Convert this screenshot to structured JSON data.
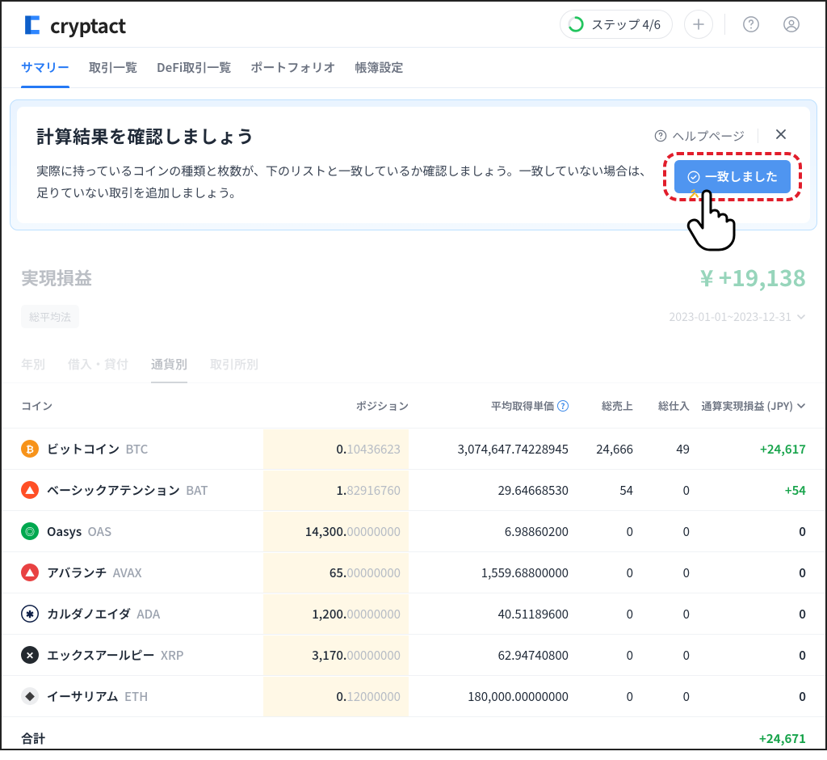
{
  "brand": "cryptact",
  "step": {
    "label": "ステップ 4/6",
    "percent": 67
  },
  "nav": [
    {
      "label": "サマリー",
      "active": true
    },
    {
      "label": "取引一覧"
    },
    {
      "label": "DeFi取引一覧"
    },
    {
      "label": "ポートフォリオ"
    },
    {
      "label": "帳簿設定"
    }
  ],
  "banner": {
    "title": "計算結果を確認しましょう",
    "help_label": "ヘルプページ",
    "text": "実際に持っているコインの種類と枚数が、下のリストと一致しているか確認しましょう。一致していない場合は、足りていない取引を追加しましょう。",
    "confirm_label": "一致しました"
  },
  "realized": {
    "title": "実現損益",
    "value": "¥ +19,138",
    "method_chip": "総平均法",
    "date_range": "2023-01-01~2023-12-31"
  },
  "filter_tabs": [
    {
      "label": "年別"
    },
    {
      "label": "借入・貸付"
    },
    {
      "label": "通貨別",
      "active": true
    },
    {
      "label": "取引所別"
    }
  ],
  "columns": {
    "coin": "コイン",
    "position": "ポジション",
    "avg_cost": "平均取得単価",
    "total_sales": "総売上",
    "total_buys": "総仕入",
    "pnl": "通算実現損益 (JPY)"
  },
  "rows": [
    {
      "icon_bg": "#f7931a",
      "glyph": "₿",
      "name": "ビットコイン",
      "sym": "BTC",
      "pos_int": "0.",
      "pos_dec": "10436623",
      "avg": "3,074,647.74228945",
      "sales": "24,666",
      "buys": "49",
      "pnl": "+24,617",
      "pnl_pos": true
    },
    {
      "icon_bg": "#ff4f26",
      "glyph": "▲",
      "name": "ベーシックアテンション",
      "sym": "BAT",
      "pos_int": "1.",
      "pos_dec": "82916760",
      "avg": "29.64668530",
      "sales": "54",
      "buys": "0",
      "pnl": "+54",
      "pnl_pos": true
    },
    {
      "icon_bg": "#00a84f",
      "glyph": "◎",
      "name": "Oasys",
      "sym": "OAS",
      "pos_int": "14,300.",
      "pos_dec": "00000000",
      "avg": "6.98860200",
      "sales": "0",
      "buys": "0",
      "pnl": "0",
      "pnl_pos": false
    },
    {
      "icon_bg": "#e84142",
      "glyph": "▲",
      "name": "アバランチ",
      "sym": "AVAX",
      "pos_int": "65.",
      "pos_dec": "00000000",
      "avg": "1,559.68800000",
      "sales": "0",
      "buys": "0",
      "pnl": "0",
      "pnl_pos": false
    },
    {
      "icon_bg": "#ffffff",
      "glyph": "✱",
      "glyph_color": "#0d1e46",
      "ring": "#0d1e46",
      "name": "カルダノエイダ",
      "sym": "ADA",
      "pos_int": "1,200.",
      "pos_dec": "00000000",
      "avg": "40.51189600",
      "sales": "0",
      "buys": "0",
      "pnl": "0",
      "pnl_pos": false
    },
    {
      "icon_bg": "#23292f",
      "glyph": "✕",
      "name": "エックスアールピー",
      "sym": "XRP",
      "pos_int": "3,170.",
      "pos_dec": "00000000",
      "avg": "62.94740800",
      "sales": "0",
      "buys": "0",
      "pnl": "0",
      "pnl_pos": false
    },
    {
      "icon_bg": "#ecedef",
      "glyph": "◆",
      "glyph_color": "#3c3c3d",
      "name": "イーサリアム",
      "sym": "ETH",
      "pos_int": "0.",
      "pos_dec": "12000000",
      "pos_dec_dark": "12",
      "avg": "180,000.00000000",
      "sales": "0",
      "buys": "0",
      "pnl": "0",
      "pnl_pos": false
    }
  ],
  "total": {
    "label": "合計",
    "pnl": "+24,671"
  }
}
